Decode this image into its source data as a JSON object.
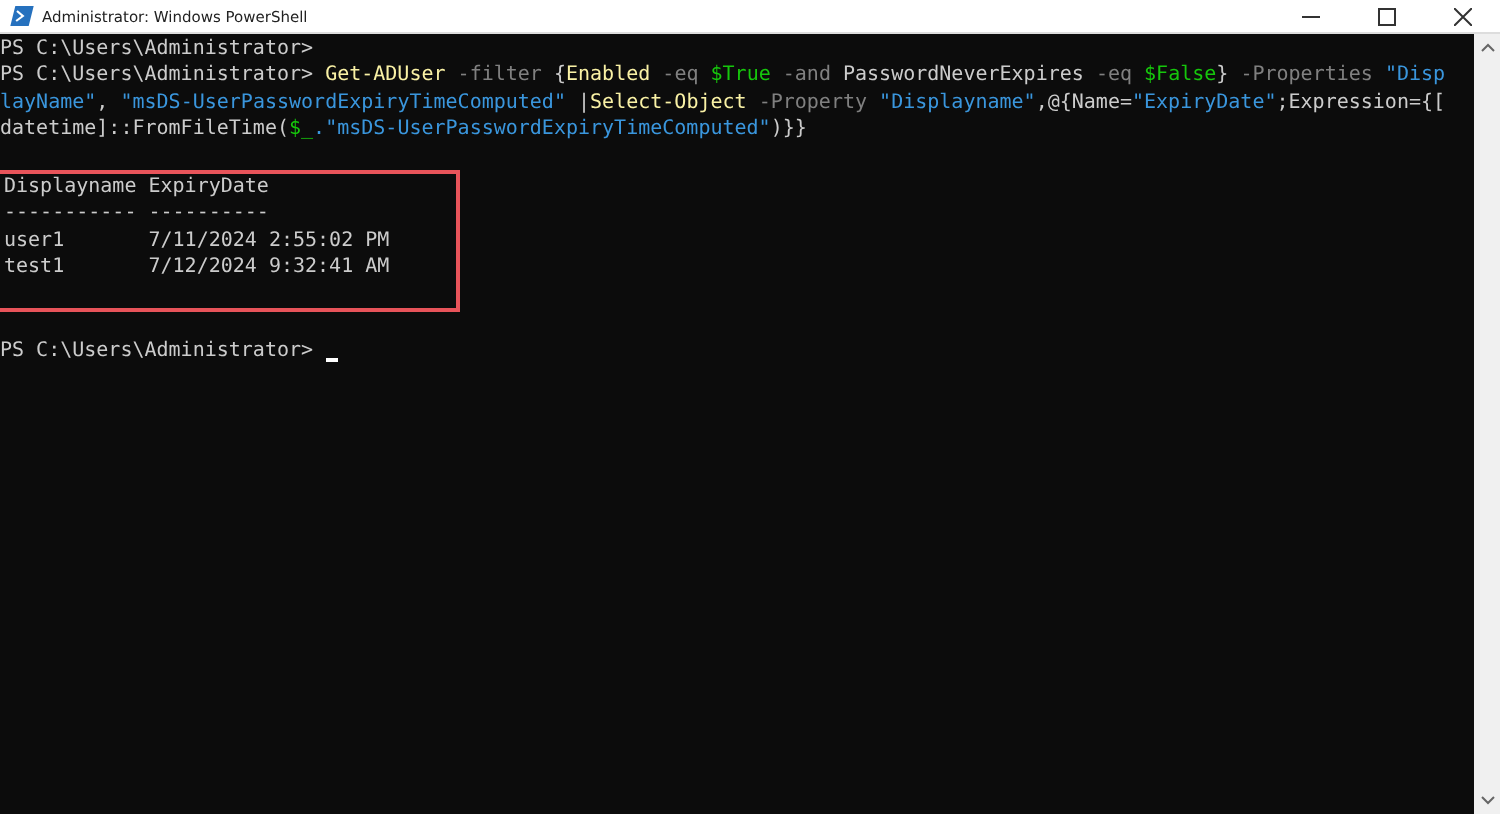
{
  "window": {
    "title": "Administrator: Windows PowerShell"
  },
  "console": {
    "lines": [
      {
        "segments": [
          {
            "kind": "plain",
            "text": "PS C:\\Users\\Administrator>"
          }
        ]
      },
      {
        "segments": [
          {
            "kind": "plain",
            "text": "PS C:\\Users\\Administrator> "
          },
          {
            "kind": "command",
            "text": "Get-ADUser"
          },
          {
            "kind": "parameter",
            "text": " -filter "
          },
          {
            "kind": "plain",
            "text": "{"
          },
          {
            "kind": "command",
            "text": "Enabled"
          },
          {
            "kind": "parameter",
            "text": " -eq "
          },
          {
            "kind": "variable",
            "text": "$True"
          },
          {
            "kind": "parameter",
            "text": " -and "
          },
          {
            "kind": "plain",
            "text": "PasswordNeverExpires"
          },
          {
            "kind": "parameter",
            "text": " -eq "
          },
          {
            "kind": "variable",
            "text": "$False"
          },
          {
            "kind": "plain",
            "text": "}"
          },
          {
            "kind": "parameter",
            "text": " -Properties "
          },
          {
            "kind": "string",
            "text": "\"Disp"
          }
        ]
      },
      {
        "segments": [
          {
            "kind": "string",
            "text": "layName\""
          },
          {
            "kind": "plain",
            "text": ", "
          },
          {
            "kind": "string",
            "text": "\"msDS-UserPasswordExpiryTimeComputed\""
          },
          {
            "kind": "plain",
            "text": " |"
          },
          {
            "kind": "command",
            "text": "Select-Object"
          },
          {
            "kind": "parameter",
            "text": " -Property "
          },
          {
            "kind": "string",
            "text": "\"Displayname\""
          },
          {
            "kind": "plain",
            "text": ",@{Name="
          },
          {
            "kind": "string",
            "text": "\"ExpiryDate\""
          },
          {
            "kind": "plain",
            "text": ";Expression={["
          }
        ]
      },
      {
        "segments": [
          {
            "kind": "plain",
            "text": "datetime]::FromFileTime("
          },
          {
            "kind": "variable",
            "text": "$_"
          },
          {
            "kind": "string",
            "text": ".\"msDS-UserPasswordExpiryTimeComputed\""
          },
          {
            "kind": "plain",
            "text": ")}}"
          }
        ]
      }
    ]
  },
  "highlighted_output": {
    "lines": [
      "Displayname ExpiryDate",
      "----------- ----------",
      "user1       7/11/2024 2:55:02 PM",
      "test1       7/12/2024 9:32:41 AM"
    ]
  },
  "prompt": {
    "text": "PS C:\\Users\\Administrator> ",
    "cursor": true
  }
}
